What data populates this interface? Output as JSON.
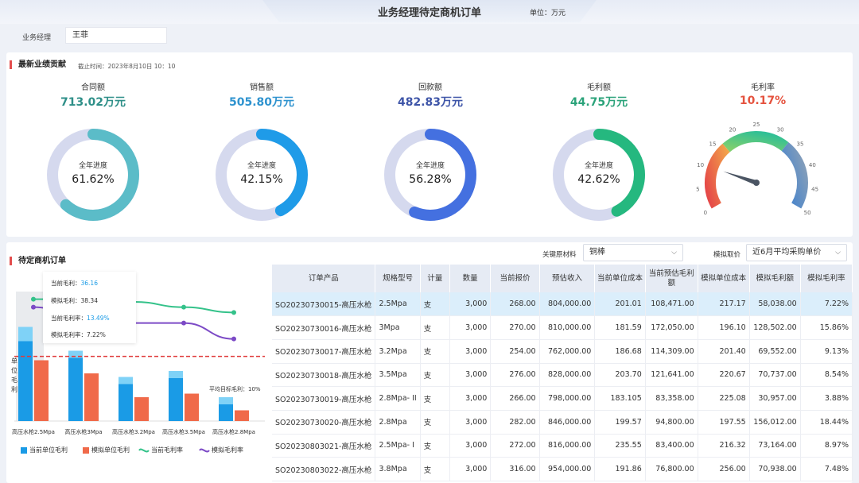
{
  "header": {
    "title": "业务经理待定商机订单",
    "unit": "单位：万元"
  },
  "filter": {
    "manager_label": "业务经理",
    "manager_value": "王菲"
  },
  "performance": {
    "title": "最新业绩贡献",
    "cutoff": "截止时间：2023年8月10日 10：10",
    "progress_label": "全年进度",
    "kpis": [
      {
        "label": "合同额",
        "value": "713.02万元",
        "progress": "61.62%",
        "progress_frac": 0.6162,
        "color": "#5bbcc8",
        "value_color": "#2e8f88"
      },
      {
        "label": "销售额",
        "value": "505.80万元",
        "progress": "42.15%",
        "progress_frac": 0.4215,
        "color": "#1f9be8",
        "value_color": "#2f93cf"
      },
      {
        "label": "回款额",
        "value": "482.83万元",
        "progress": "56.28%",
        "progress_frac": 0.5628,
        "color": "#4470e0",
        "value_color": "#3e55a8"
      },
      {
        "label": "毛利额",
        "value": "44.75万元",
        "progress": "42.62%",
        "progress_frac": 0.4262,
        "color": "#25b87f",
        "value_color": "#2ba37a"
      }
    ],
    "gauge": {
      "label": "毛利率",
      "value": "10.17%",
      "value_num": 10.17,
      "value_color": "#e5533f",
      "ticks": [
        "0",
        "5",
        "10",
        "15",
        "20",
        "25",
        "30",
        "35",
        "40",
        "45",
        "50"
      ]
    }
  },
  "orders": {
    "title": "待定商机订单",
    "material_label": "关键原材料",
    "material_value": "铜棒",
    "price_label": "模拟取价",
    "price_value": "近6月平均采购单价",
    "columns": [
      "订单产品",
      "规格型号",
      "计量",
      "数量",
      "当前报价",
      "预估收入",
      "当前单位成本",
      "当前预估毛利额",
      "模拟单位成本",
      "模拟毛利额",
      "模拟毛利率"
    ],
    "rows": [
      [
        "SO20230730015-高压水枪",
        "2.5Mpa",
        "支",
        "3,000",
        "268.00",
        "804,000.00",
        "201.01",
        "108,471.00",
        "217.17",
        "58,038.00",
        "7.22%"
      ],
      [
        "SO20230730016-高压水枪",
        "3Mpa",
        "支",
        "3,000",
        "270.00",
        "810,000.00",
        "181.59",
        "172,050.00",
        "196.10",
        "128,502.00",
        "15.86%"
      ],
      [
        "SO20230730017-高压水枪",
        "3.2Mpa",
        "支",
        "3,000",
        "254.00",
        "762,000.00",
        "186.68",
        "114,309.00",
        "201.40",
        "69,552.00",
        "9.13%"
      ],
      [
        "SO20230730018-高压水枪",
        "3.5Mpa",
        "支",
        "3,000",
        "276.00",
        "828,000.00",
        "203.70",
        "121,641.00",
        "220.67",
        "70,737.00",
        "8.54%"
      ],
      [
        "SO20230730019-高压水枪",
        "2.8Mpa- II",
        "支",
        "3,000",
        "266.00",
        "798,000.00",
        "183.105",
        "83,358.00",
        "225.08",
        "30,957.00",
        "3.88%"
      ],
      [
        "SO20230730020-高压水枪",
        "2.8Mpa",
        "支",
        "3,000",
        "282.00",
        "846,000.00",
        "199.57",
        "94,800.00",
        "197.55",
        "156,012.00",
        "18.44%"
      ],
      [
        "SO20230803021-高压水枪",
        "2.5Mpa- I",
        "支",
        "3,000",
        "272.00",
        "816,000.00",
        "235.55",
        "83,400.00",
        "216.32",
        "73,164.00",
        "8.97%"
      ],
      [
        "SO20230803022-高压水枪",
        "3.8Mpa",
        "支",
        "3,000",
        "316.00",
        "954,000.00",
        "191.86",
        "76,800.00",
        "256.00",
        "70,938.00",
        "7.48%"
      ]
    ]
  },
  "tooltip": {
    "l1": "当前毛利：",
    "v1": "36.16",
    "l2": "模拟毛利：",
    "v2": "38.34",
    "l3": "当前毛利率：",
    "v3": "13.49%",
    "l4": "模拟毛利率：",
    "v4": "7.22%"
  },
  "chart_data": {
    "type": "bar",
    "categories": [
      "高压水枪2.5Mpa",
      "高压水枪3Mpa",
      "高压水枪3.2Mpa",
      "高压水枪3.5Mpa",
      "高压水枪2.8Mpa"
    ],
    "ylabel": "单位毛利",
    "series": [
      {
        "name": "当前单位毛利",
        "type": "bar",
        "values": [
          67,
          53,
          31,
          36,
          14
        ],
        "color": "#1a9be6"
      },
      {
        "name": "模拟单位毛利",
        "type": "bar",
        "values": [
          51,
          40,
          20,
          23,
          9
        ],
        "color": "#f06a4a"
      },
      {
        "name": "当前毛利率",
        "type": "line",
        "values": [
          25,
          25,
          24,
          22,
          20
        ],
        "color": "#34c28a"
      },
      {
        "name": "模拟毛利率",
        "type": "line",
        "values": [
          22,
          18,
          16,
          16,
          10
        ],
        "color": "#7c4ac6"
      }
    ],
    "overlay_values": [
      36.16,
      38.34
    ],
    "target": {
      "label": "平均目标毛利：10%",
      "value": 10
    },
    "bar_ymax": 100,
    "rate_ymax": 45
  }
}
